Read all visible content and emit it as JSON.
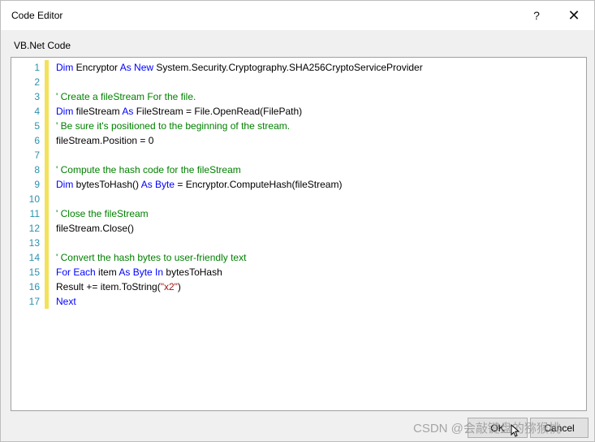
{
  "window": {
    "title": "Code Editor",
    "help_label": "?",
    "close_label": "✕"
  },
  "editor": {
    "label": "VB.Net Code",
    "language": "VB.Net",
    "colors": {
      "keyword": "#0000ff",
      "comment": "#008000",
      "string": "#a31515",
      "line_number": "#2b91af",
      "margin_marker": "#f2e25a"
    },
    "lines": [
      {
        "n": "1",
        "tokens": [
          {
            "t": "kw",
            "v": "Dim"
          },
          {
            "t": "tx",
            "v": " Encryptor "
          },
          {
            "t": "kw",
            "v": "As New"
          },
          {
            "t": "tx",
            "v": " System.Security.Cryptography.SHA256CryptoServiceProvider"
          }
        ]
      },
      {
        "n": "2",
        "tokens": []
      },
      {
        "n": "3",
        "tokens": [
          {
            "t": "cm",
            "v": "' Create a fileStream For the file."
          }
        ]
      },
      {
        "n": "4",
        "tokens": [
          {
            "t": "kw",
            "v": "Dim"
          },
          {
            "t": "tx",
            "v": " fileStream "
          },
          {
            "t": "kw",
            "v": "As"
          },
          {
            "t": "tx",
            "v": " FileStream = File.OpenRead(FilePath)"
          }
        ]
      },
      {
        "n": "5",
        "tokens": [
          {
            "t": "cm",
            "v": "' Be sure it's positioned to the beginning of the stream."
          }
        ]
      },
      {
        "n": "6",
        "tokens": [
          {
            "t": "tx",
            "v": "fileStream.Position = 0"
          }
        ]
      },
      {
        "n": "7",
        "tokens": []
      },
      {
        "n": "8",
        "tokens": [
          {
            "t": "cm",
            "v": "' Compute the hash code for the fileStream"
          }
        ]
      },
      {
        "n": "9",
        "tokens": [
          {
            "t": "kw",
            "v": "Dim"
          },
          {
            "t": "tx",
            "v": " bytesToHash() "
          },
          {
            "t": "kw",
            "v": "As Byte"
          },
          {
            "t": "tx",
            "v": " = Encryptor.ComputeHash(fileStream)"
          }
        ]
      },
      {
        "n": "10",
        "tokens": []
      },
      {
        "n": "11",
        "tokens": [
          {
            "t": "cm",
            "v": "' Close the fileStream"
          }
        ]
      },
      {
        "n": "12",
        "tokens": [
          {
            "t": "tx",
            "v": "fileStream.Close()"
          }
        ]
      },
      {
        "n": "13",
        "tokens": []
      },
      {
        "n": "14",
        "tokens": [
          {
            "t": "cm",
            "v": "' Convert the hash bytes to user-friendly text"
          }
        ]
      },
      {
        "n": "15",
        "tokens": [
          {
            "t": "kw",
            "v": "For Each"
          },
          {
            "t": "tx",
            "v": " item "
          },
          {
            "t": "kw",
            "v": "As Byte In"
          },
          {
            "t": "tx",
            "v": " bytesToHash"
          }
        ]
      },
      {
        "n": "16",
        "tokens": [
          {
            "t": "tx",
            "v": "Result += item.ToString("
          },
          {
            "t": "str",
            "v": "\"x2\""
          },
          {
            "t": "tx",
            "v": ")"
          }
        ]
      },
      {
        "n": "17",
        "tokens": [
          {
            "t": "kw",
            "v": "Next"
          }
        ]
      }
    ]
  },
  "footer": {
    "ok_label": "OK",
    "cancel_label": "Cancel"
  },
  "watermark": "CSDN @会敲键盘的猕猴桃"
}
